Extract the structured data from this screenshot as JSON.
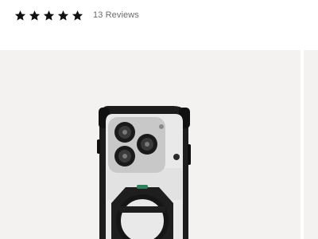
{
  "rating": {
    "stars": 5,
    "max_stars": 5,
    "star_color": "#111111",
    "reviews_label": "13 Reviews"
  },
  "gallery": {
    "background": "#f3f2f1",
    "product_image": "phone-case-image"
  },
  "colors": {
    "text_muted": "#6b6b6b",
    "case_frame": "#1c1c1c",
    "case_clear": "#e9e9e9"
  }
}
